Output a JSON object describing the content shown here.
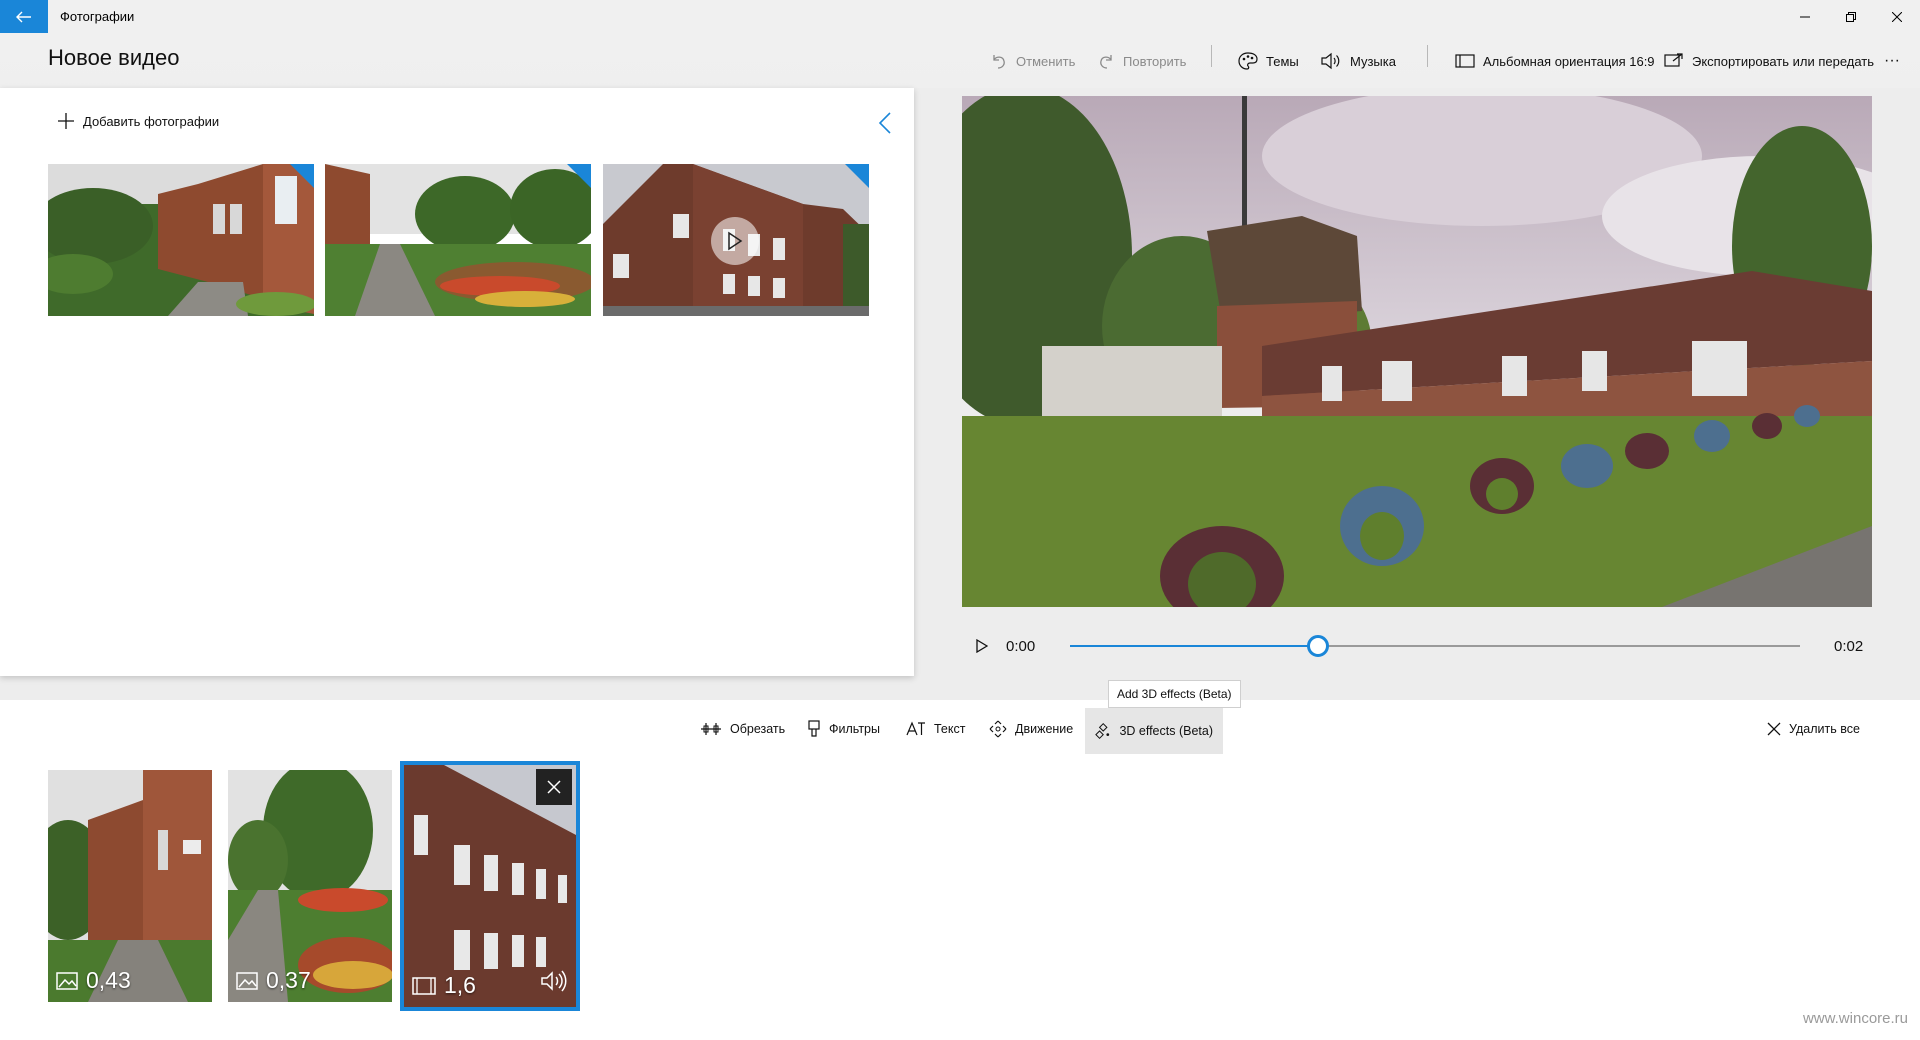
{
  "app": {
    "name": "Фотографии",
    "project_title": "Новое видео"
  },
  "toolbar": {
    "undo": "Отменить",
    "redo": "Повторить",
    "themes": "Темы",
    "music": "Музыка",
    "aspect": "Альбомная ориентация 16:9",
    "export": "Экспортировать или передать",
    "more": "···"
  },
  "library": {
    "add_label": "Добавить фотографии",
    "items": [
      {
        "type": "photo",
        "added": true
      },
      {
        "type": "photo",
        "added": true
      },
      {
        "type": "video",
        "added": true
      }
    ]
  },
  "player": {
    "current_time": "0:00",
    "total_time": "0:02",
    "progress_fraction": 0.34
  },
  "tooltip": "Add 3D effects (Beta)",
  "storyboard": {
    "tools": [
      {
        "label": "Обрезать",
        "icon": "trim-icon"
      },
      {
        "label": "Фильтры",
        "icon": "filters-icon"
      },
      {
        "label": "Текст",
        "icon": "text-icon"
      },
      {
        "label": "Движение",
        "icon": "motion-icon"
      },
      {
        "label": "3D effects (Beta)",
        "icon": "3d-effects-icon"
      }
    ],
    "delete_all": "Удалить все",
    "clips": [
      {
        "type": "photo",
        "duration": "0,43",
        "selected": false
      },
      {
        "type": "photo",
        "duration": "0,37",
        "selected": false
      },
      {
        "type": "video",
        "duration": "1,6",
        "selected": true
      }
    ]
  },
  "watermark": "www.wincore.ru",
  "colors": {
    "accent": "#1a86d8"
  }
}
